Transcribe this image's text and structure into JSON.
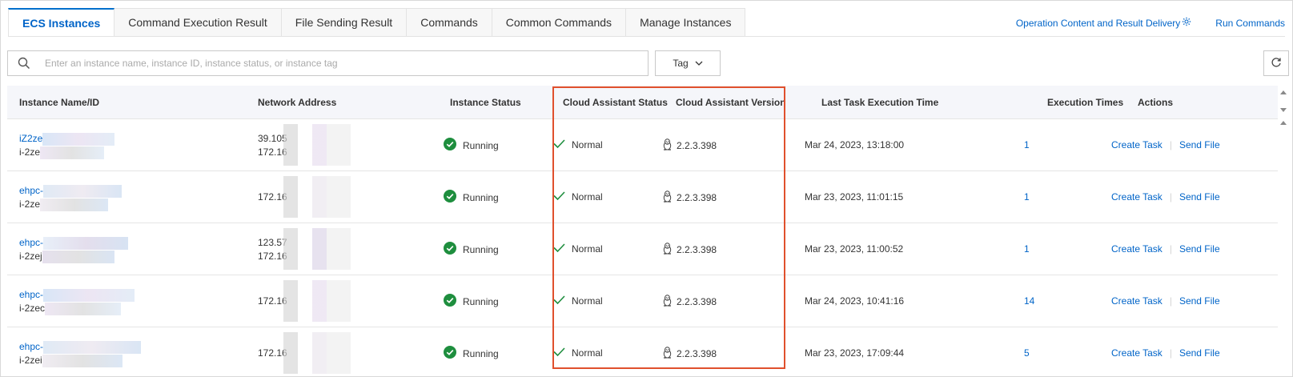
{
  "tabs": [
    {
      "label": "ECS Instances",
      "active": true
    },
    {
      "label": "Command Execution Result",
      "active": false
    },
    {
      "label": "File Sending Result",
      "active": false
    },
    {
      "label": "Commands",
      "active": false
    },
    {
      "label": "Common Commands",
      "active": false
    },
    {
      "label": "Manage Instances",
      "active": false
    }
  ],
  "top_links": {
    "delivery": "Operation Content and Result Delivery",
    "run_commands": "Run Commands"
  },
  "search": {
    "placeholder": "Enter an instance name, instance ID, instance status, or instance tag",
    "value": ""
  },
  "tag_button": "Tag",
  "table": {
    "columns": [
      "Instance Name/ID",
      "Network Address",
      "Instance Status",
      "Cloud Assistant Status",
      "Cloud Assistant Version",
      "Last Task Execution Time",
      "Execution Times",
      "Actions"
    ],
    "rows": [
      {
        "name": "iZ2ze",
        "id": "i-2ze",
        "ip1": "39.105",
        "ip2": "172.16",
        "status": "Running",
        "assistant_status": "Normal",
        "version": "2.2.3.398",
        "last_time": "Mar 24, 2023, 13:18:00",
        "times": "1"
      },
      {
        "name": "ehpc-",
        "id": "i-2ze",
        "ip1": "",
        "ip2": "172.16",
        "status": "Running",
        "assistant_status": "Normal",
        "version": "2.2.3.398",
        "last_time": "Mar 23, 2023, 11:01:15",
        "times": "1"
      },
      {
        "name": "ehpc-",
        "id": "i-2zej",
        "ip1": "123.57",
        "ip2": "172.16",
        "status": "Running",
        "assistant_status": "Normal",
        "version": "2.2.3.398",
        "last_time": "Mar 23, 2023, 11:00:52",
        "times": "1"
      },
      {
        "name": "ehpc-",
        "id": "i-2zec",
        "ip1": "",
        "ip2": "172.16",
        "status": "Running",
        "assistant_status": "Normal",
        "version": "2.2.3.398",
        "last_time": "Mar 24, 2023, 10:41:16",
        "times": "14"
      },
      {
        "name": "ehpc-",
        "id": "i-2zei",
        "ip1": "",
        "ip2": "172.16",
        "status": "Running",
        "assistant_status": "Normal",
        "version": "2.2.3.398",
        "last_time": "Mar 23, 2023, 17:09:44",
        "times": "5"
      }
    ],
    "actions": {
      "create": "Create Task",
      "send": "Send File"
    }
  },
  "colors": {
    "link": "#0064c8",
    "running": "#1e8e3e",
    "normal_check": "#1e8e3e",
    "highlight": "#e0502d"
  },
  "icons": {
    "search": "search-icon",
    "tag_caret": "chevron-down-icon",
    "refresh": "refresh-icon",
    "settings": "gear-icon",
    "os": "linux-penguin-icon",
    "status": "check-circle-icon",
    "check": "checkmark-icon"
  }
}
